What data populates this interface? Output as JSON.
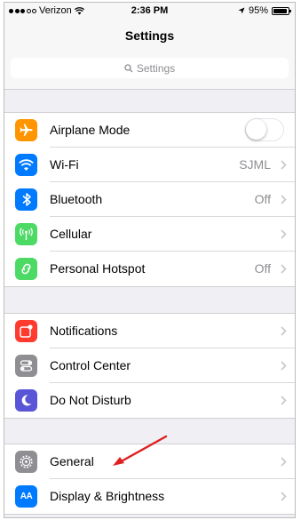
{
  "status_bar": {
    "carrier": "Verizon",
    "time": "2:36 PM",
    "battery": "95%",
    "battery_level": 0.95
  },
  "header": {
    "title": "Settings",
    "search_placeholder": "Settings"
  },
  "groups": [
    {
      "rows": [
        {
          "label": "Airplane Mode",
          "icon": "airplane-icon",
          "color": "#FF9500",
          "toggle": false
        },
        {
          "label": "Wi-Fi",
          "icon": "wifi-icon",
          "color": "#007AFF",
          "value": "SJML"
        },
        {
          "label": "Bluetooth",
          "icon": "bluetooth-icon",
          "color": "#007AFF",
          "value": "Off"
        },
        {
          "label": "Cellular",
          "icon": "cellular-icon",
          "color": "#4CD964"
        },
        {
          "label": "Personal Hotspot",
          "icon": "hotspot-icon",
          "color": "#4CD964",
          "value": "Off"
        }
      ]
    },
    {
      "rows": [
        {
          "label": "Notifications",
          "icon": "notifications-icon",
          "color": "#FF3B30"
        },
        {
          "label": "Control Center",
          "icon": "control-center-icon",
          "color": "#8E8E93"
        },
        {
          "label": "Do Not Disturb",
          "icon": "moon-icon",
          "color": "#5856D6"
        }
      ]
    },
    {
      "rows": [
        {
          "label": "General",
          "icon": "gear-icon",
          "color": "#8E8E93"
        },
        {
          "label": "Display & Brightness",
          "icon": "display-brightness-icon",
          "color": "#007AFF",
          "icon_text": "AA"
        }
      ]
    }
  ],
  "annotation": {
    "arrow_color": "#E02020",
    "points_to": "General"
  }
}
